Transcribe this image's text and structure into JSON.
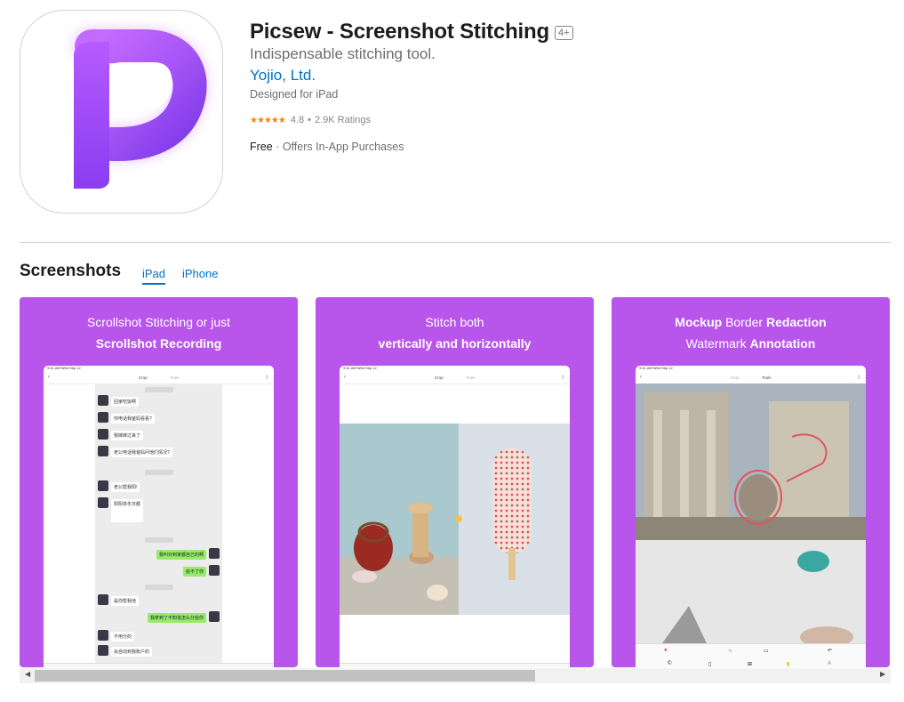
{
  "app": {
    "title": "Picsew - Screenshot Stitching",
    "age_rating": "4+",
    "subtitle": "Indispensable stitching tool.",
    "developer": "Yojio, Ltd.",
    "designed_for": "Designed for iPad",
    "stars": "★★★★★",
    "rating": "4.8",
    "rating_separator": "•",
    "ratings_count": "2.9K Ratings",
    "price": "Free",
    "price_separator": " · ",
    "iap": "Offers In-App Purchases",
    "icon_name": "picsew-p-logo-icon",
    "brand_color": "#b855ea"
  },
  "screenshots": {
    "title": "Screenshots",
    "tabs": [
      {
        "label": "iPad",
        "selected": true
      },
      {
        "label": "iPhone",
        "selected": false
      }
    ],
    "items": [
      {
        "caption_line1": "Scrollshot Stitching or just",
        "caption_line2": "Scrollshot Recording"
      },
      {
        "caption_line1": "Stitch both",
        "caption_line2": "vertically and horizontally"
      },
      {
        "caption_line1_a": "Mockup",
        "caption_line1_b": "Border",
        "caption_line1_c": "Redaction",
        "caption_line2_a": "Watermark",
        "caption_line2_b": "Annotation"
      }
    ]
  },
  "device": {
    "status": "9:41 AM  Wed Sep 12",
    "crop": "Crop",
    "tools": "Tools"
  },
  "chat": {
    "messages": [
      {
        "side": "l",
        "text": "回家吃饭啊"
      },
      {
        "side": "l",
        "text": "你电话我爸妈看看?"
      },
      {
        "side": "l",
        "text": "我嫁嫁过来了"
      },
      {
        "side": "l",
        "text": "老公电话我爸妈问他们情况?"
      },
      {
        "side": "l",
        "text": "老公帮我阳!"
      },
      {
        "side": "l",
        "text": "阳阳将冬日都"
      },
      {
        "side": "r",
        "text": "我叫对到家都自己的啊"
      },
      {
        "side": "r",
        "text": "给不了你"
      },
      {
        "side": "l",
        "text": "是你帮我他"
      },
      {
        "side": "r",
        "text": "我拿到了不知道怎么分给你"
      },
      {
        "side": "l",
        "text": "不用分的"
      },
      {
        "side": "l",
        "text": "会自动到我账户的"
      }
    ]
  }
}
